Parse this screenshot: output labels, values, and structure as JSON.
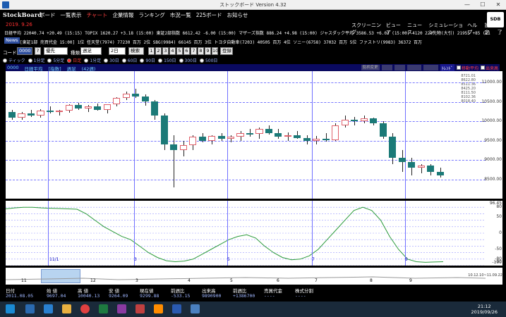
{
  "window": {
    "title": "ストックボード Version 4.32",
    "minimize": "—",
    "maximize": "☐",
    "close": "✕"
  },
  "menu": {
    "logo": "StockBoard",
    "items": [
      "ボード",
      "一覧表示",
      "チャート",
      "企業情報",
      "ランキング",
      "市況一覧",
      "225ボード",
      "お知らせ"
    ],
    "active_index": 2,
    "date": "2019. 9.26",
    "sub_items": [
      "スクリーニング",
      "ビューア",
      "ニュース",
      "シミュレーション",
      "ヘルプ",
      "設定",
      "終了"
    ],
    "badge": "SDB"
  },
  "ticker": {
    "line1": "日経平均 22040.74 +20.49 (15:15)   TOPIX 1620.27 +3.18 (15:00)   東証2部指数 6612.42 -6.00 (15:00)   マザーズ指数 886.24 +4.98 (15:00)   ジャスダック平均 3586.53 +6.03 (15:00)   4120 225先物(大引) 21955 +85 (21:12)",
    "news_tag": "News",
    "line2": "[東証1部 売買代金 15:00]  1位 任天堂(7974) 77230 百万   2位 SBG(9984) 66145 百万   3位 トヨタ自動車(7203) 40505 百万   4位 ソニー(6758) 37032 百万   5位 ファストリ(9983) 36372 百万"
  },
  "toolbar": {
    "code_label": "コード",
    "code_value": "0000",
    "q_btn": "?",
    "market_value": "優先",
    "kind_label": "種類",
    "kind_value": "週足",
    "period_value": "2日",
    "search_btn": "検索",
    "nums": [
      "1",
      "2",
      "3",
      "4",
      "5",
      "6",
      "7",
      "8",
      "9",
      "10"
    ],
    "register_btn": "登録"
  },
  "radios": [
    {
      "label": "ティック",
      "selected": false
    },
    {
      "label": "1分足",
      "selected": false
    },
    {
      "label": "5分足",
      "selected": false
    },
    {
      "label": "日足",
      "selected": true
    },
    {
      "label": "1分足",
      "selected": false
    },
    {
      "label": "30日",
      "selected": false
    },
    {
      "label": "60日",
      "selected": false
    },
    {
      "label": "90日",
      "selected": false
    },
    {
      "label": "150日",
      "selected": false
    },
    {
      "label": "300日",
      "selected": false
    },
    {
      "label": "500日",
      "selected": false
    }
  ],
  "chart_header": {
    "code": "0000",
    "name": "日経平均",
    "kind": "[指数]",
    "period": "週足",
    "count": "(42週)",
    "btn1": "銘柄変更",
    "btn2": "ﾄﾚﾝﾄﾞ",
    "check1": "移動平均",
    "check2": "出来高"
  },
  "chart_data": {
    "type": "candlestick",
    "title": "0000 日経平均 [指数] 週足 (42週)",
    "y_ticks": [
      8500,
      9000,
      9500,
      10000,
      10500,
      11000
    ],
    "ylim": [
      8000,
      11300
    ],
    "x_labels": [
      "11",
      "12",
      "3",
      "4",
      "5",
      "6",
      "7",
      "8",
      "9"
    ],
    "month_markers": [
      "11/1",
      "3",
      "5",
      "7",
      "9"
    ],
    "candles": [
      {
        "o": 10250,
        "h": 10300,
        "l": 10050,
        "c": 10100
      },
      {
        "o": 10100,
        "h": 10250,
        "l": 10050,
        "c": 10200
      },
      {
        "o": 10200,
        "h": 10300,
        "l": 10120,
        "c": 10150
      },
      {
        "o": 10150,
        "h": 10320,
        "l": 10100,
        "c": 10280
      },
      {
        "o": 10280,
        "h": 10380,
        "l": 10200,
        "c": 10250
      },
      {
        "o": 10250,
        "h": 10300,
        "l": 10150,
        "c": 10270
      },
      {
        "o": 10270,
        "h": 10450,
        "l": 10220,
        "c": 10420
      },
      {
        "o": 10420,
        "h": 10480,
        "l": 10300,
        "c": 10330
      },
      {
        "o": 10330,
        "h": 10420,
        "l": 10250,
        "c": 10380
      },
      {
        "o": 10380,
        "h": 10460,
        "l": 10280,
        "c": 10300
      },
      {
        "o": 10300,
        "h": 10450,
        "l": 10200,
        "c": 10440
      },
      {
        "o": 10440,
        "h": 10620,
        "l": 10380,
        "c": 10600
      },
      {
        "o": 10600,
        "h": 10780,
        "l": 10550,
        "c": 10720
      },
      {
        "o": 10720,
        "h": 10850,
        "l": 10600,
        "c": 10650
      },
      {
        "o": 10650,
        "h": 10700,
        "l": 10400,
        "c": 10520
      },
      {
        "o": 10520,
        "h": 10560,
        "l": 10050,
        "c": 10150
      },
      {
        "o": 10150,
        "h": 10200,
        "l": 9250,
        "c": 9400
      },
      {
        "o": 9400,
        "h": 9650,
        "l": 8300,
        "c": 9250
      },
      {
        "o": 9250,
        "h": 9500,
        "l": 9100,
        "c": 9380
      },
      {
        "o": 9380,
        "h": 9650,
        "l": 9250,
        "c": 9600
      },
      {
        "o": 9600,
        "h": 9700,
        "l": 9450,
        "c": 9500
      },
      {
        "o": 9500,
        "h": 9650,
        "l": 9400,
        "c": 9620
      },
      {
        "o": 9620,
        "h": 9700,
        "l": 9500,
        "c": 9550
      },
      {
        "o": 9550,
        "h": 9650,
        "l": 9450,
        "c": 9600
      },
      {
        "o": 9600,
        "h": 9750,
        "l": 9500,
        "c": 9700
      },
      {
        "o": 9700,
        "h": 9800,
        "l": 9600,
        "c": 9680
      },
      {
        "o": 9680,
        "h": 9850,
        "l": 9550,
        "c": 9800
      },
      {
        "o": 9800,
        "h": 9900,
        "l": 9650,
        "c": 9700
      },
      {
        "o": 9700,
        "h": 9800,
        "l": 9550,
        "c": 9600
      },
      {
        "o": 9600,
        "h": 9720,
        "l": 9500,
        "c": 9650
      },
      {
        "o": 9650,
        "h": 9750,
        "l": 9550,
        "c": 9570
      },
      {
        "o": 9570,
        "h": 9650,
        "l": 9400,
        "c": 9500
      },
      {
        "o": 9500,
        "h": 9620,
        "l": 9400,
        "c": 9550
      },
      {
        "o": 9550,
        "h": 9700,
        "l": 9480,
        "c": 9520
      },
      {
        "o": 9520,
        "h": 9950,
        "l": 9500,
        "c": 9900
      },
      {
        "o": 9900,
        "h": 10150,
        "l": 9850,
        "c": 10050
      },
      {
        "o": 10050,
        "h": 10120,
        "l": 9900,
        "c": 10000
      },
      {
        "o": 10000,
        "h": 10150,
        "l": 9950,
        "c": 10080
      },
      {
        "o": 10080,
        "h": 10100,
        "l": 9900,
        "c": 9950
      },
      {
        "o": 9950,
        "h": 10000,
        "l": 9550,
        "c": 9600
      },
      {
        "o": 9600,
        "h": 9700,
        "l": 8900,
        "c": 9050
      },
      {
        "o": 9050,
        "h": 9250,
        "l": 8700,
        "c": 8950
      },
      {
        "o": 8950,
        "h": 9050,
        "l": 8600,
        "c": 8800
      },
      {
        "o": 8800,
        "h": 8900,
        "l": 8650,
        "c": 8850
      },
      {
        "o": 8850,
        "h": 8900,
        "l": 8600,
        "c": 8700
      },
      {
        "o": 8700,
        "h": 8800,
        "l": 8550,
        "c": 8600
      }
    ],
    "osc_ticks": [
      80,
      60,
      40,
      20,
      0,
      -20,
      -40,
      -60,
      -80,
      -100
    ],
    "osc_labels": [
      "96.45",
      "80",
      "50",
      "0",
      "-50",
      "-80",
      "-90",
      "-100"
    ],
    "osc_values": [
      75,
      78,
      80,
      80,
      78,
      77,
      76,
      75,
      74,
      60,
      40,
      20,
      5,
      -10,
      -20,
      -40,
      -60,
      -75,
      -85,
      -88,
      -86,
      -80,
      -65,
      -50,
      -35,
      -20,
      -10,
      -5,
      -15,
      -40,
      -60,
      -75,
      -82,
      -80,
      -70,
      -50,
      -20,
      10,
      40,
      70,
      80,
      70,
      40,
      -10,
      -50,
      -80,
      -88,
      -90,
      -89,
      -88
    ],
    "nav_range": "10.12.10~11.09.22"
  },
  "stock_list": [
    "8721.01",
    "8622.80",
    "8511.36",
    "8425.20",
    "8111.50",
    "8102.36",
    "8018.40"
  ],
  "data_table": {
    "headers": [
      "日付",
      "始 値",
      "高 値",
      "安 値",
      "現在値",
      "前週比",
      "出来高",
      "前週比",
      "売買代金",
      "株式分割"
    ],
    "values": [
      "2011.08.05",
      "9697.04",
      "10040.13",
      "9264.09",
      "9299.88",
      "-533.15",
      "9890900",
      "+1386700",
      "----",
      "----"
    ]
  },
  "clock": {
    "time": "21:12",
    "date": "2019/09/26"
  }
}
